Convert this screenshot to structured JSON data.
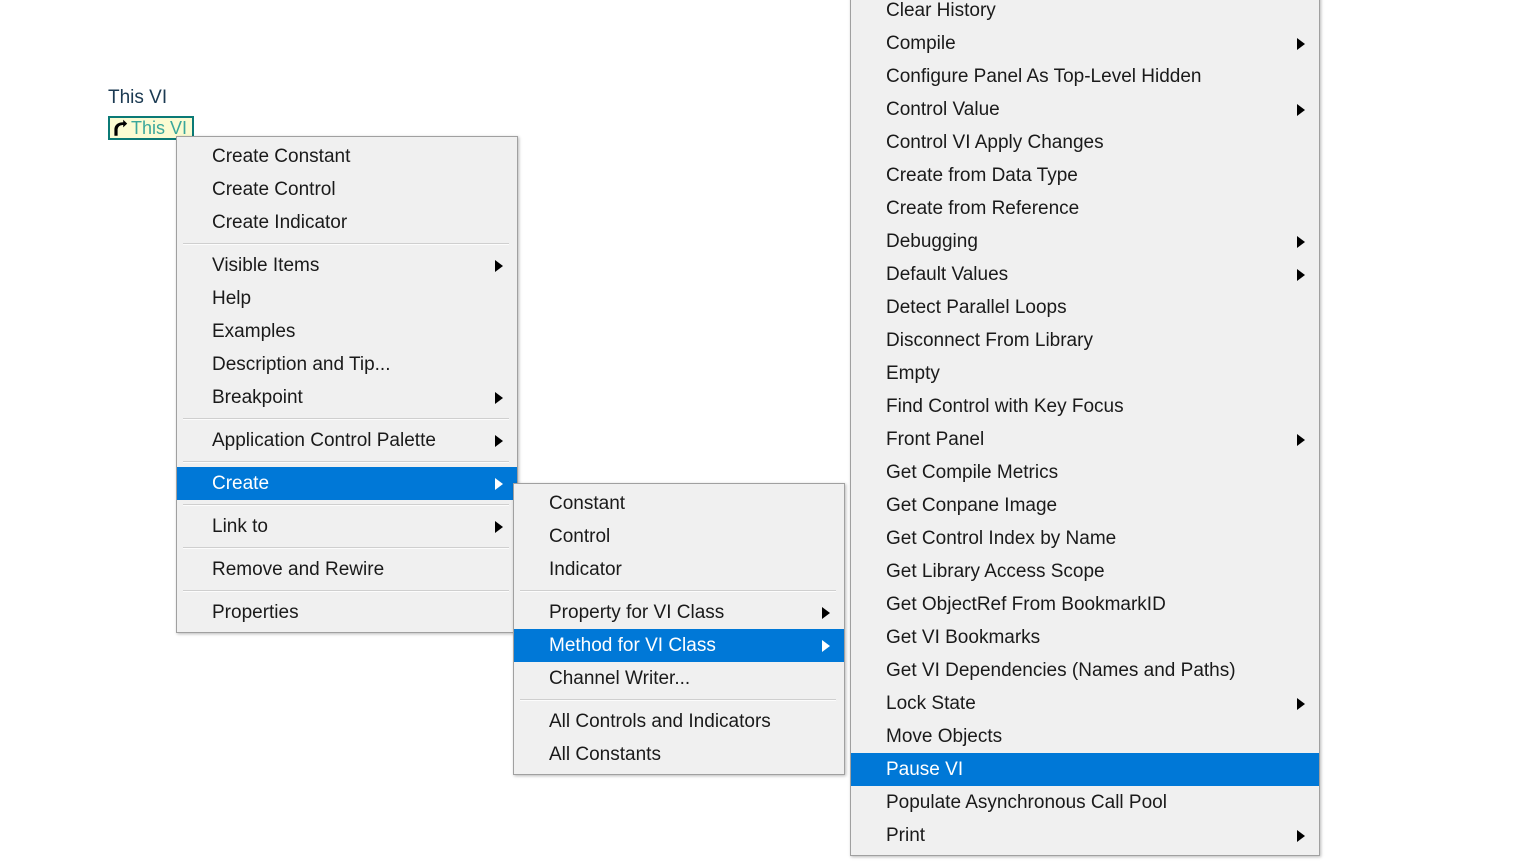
{
  "diagram": {
    "node_caption": "This VI",
    "node_label": "This VI",
    "node_icon": "this-vi-reference-icon",
    "node_border_color": "#0b7a76",
    "node_background_color": "#fbfbd2",
    "node_text_color": "#3aa79b",
    "caption_text_color": "#1b3a52"
  },
  "theme": {
    "menu_background": "#f0f0f0",
    "menu_border": "#a0a0a0",
    "menu_text": "#1a1a1a",
    "highlight_background": "#0078d7",
    "highlight_text": "#ffffff",
    "separator": "#cfcfcf"
  },
  "menus": {
    "primary": {
      "name": "this-vi-context-menu",
      "items": [
        {
          "label": "Create Constant",
          "submenu": false,
          "highlighted": false
        },
        {
          "label": "Create Control",
          "submenu": false,
          "highlighted": false
        },
        {
          "label": "Create Indicator",
          "submenu": false,
          "highlighted": false
        },
        {
          "separator": true
        },
        {
          "label": "Visible Items",
          "submenu": true,
          "highlighted": false
        },
        {
          "label": "Help",
          "submenu": false,
          "highlighted": false
        },
        {
          "label": "Examples",
          "submenu": false,
          "highlighted": false
        },
        {
          "label": "Description and Tip...",
          "submenu": false,
          "highlighted": false
        },
        {
          "label": "Breakpoint",
          "submenu": true,
          "highlighted": false
        },
        {
          "separator": true
        },
        {
          "label": "Application Control Palette",
          "submenu": true,
          "highlighted": false
        },
        {
          "separator": true
        },
        {
          "label": "Create",
          "submenu": true,
          "highlighted": true
        },
        {
          "separator": true
        },
        {
          "label": "Link to",
          "submenu": true,
          "highlighted": false
        },
        {
          "separator": true
        },
        {
          "label": "Remove and Rewire",
          "submenu": false,
          "highlighted": false
        },
        {
          "separator": true
        },
        {
          "label": "Properties",
          "submenu": false,
          "highlighted": false
        }
      ]
    },
    "create": {
      "name": "create-submenu",
      "items": [
        {
          "label": "Constant",
          "submenu": false,
          "highlighted": false
        },
        {
          "label": "Control",
          "submenu": false,
          "highlighted": false
        },
        {
          "label": "Indicator",
          "submenu": false,
          "highlighted": false
        },
        {
          "separator": true
        },
        {
          "label": "Property for VI Class",
          "submenu": true,
          "highlighted": false
        },
        {
          "label": "Method for VI Class",
          "submenu": true,
          "highlighted": true
        },
        {
          "label": "Channel Writer...",
          "submenu": false,
          "highlighted": false
        },
        {
          "separator": true
        },
        {
          "label": "All Controls and Indicators",
          "submenu": false,
          "highlighted": false
        },
        {
          "label": "All Constants",
          "submenu": false,
          "highlighted": false
        }
      ]
    },
    "method": {
      "name": "method-for-vi-class-submenu",
      "items": [
        {
          "label": "Clear History",
          "submenu": false,
          "highlighted": false
        },
        {
          "label": "Compile",
          "submenu": true,
          "highlighted": false
        },
        {
          "label": "Configure Panel As Top-Level Hidden",
          "submenu": false,
          "highlighted": false
        },
        {
          "label": "Control Value",
          "submenu": true,
          "highlighted": false
        },
        {
          "label": "Control VI Apply Changes",
          "submenu": false,
          "highlighted": false
        },
        {
          "label": "Create from Data Type",
          "submenu": false,
          "highlighted": false
        },
        {
          "label": "Create from Reference",
          "submenu": false,
          "highlighted": false
        },
        {
          "label": "Debugging",
          "submenu": true,
          "highlighted": false
        },
        {
          "label": "Default Values",
          "submenu": true,
          "highlighted": false
        },
        {
          "label": "Detect Parallel Loops",
          "submenu": false,
          "highlighted": false
        },
        {
          "label": "Disconnect From Library",
          "submenu": false,
          "highlighted": false
        },
        {
          "label": "Empty",
          "submenu": false,
          "highlighted": false
        },
        {
          "label": "Find Control with Key Focus",
          "submenu": false,
          "highlighted": false
        },
        {
          "label": "Front Panel",
          "submenu": true,
          "highlighted": false
        },
        {
          "label": "Get Compile Metrics",
          "submenu": false,
          "highlighted": false
        },
        {
          "label": "Get Conpane Image",
          "submenu": false,
          "highlighted": false
        },
        {
          "label": "Get Control Index by Name",
          "submenu": false,
          "highlighted": false
        },
        {
          "label": "Get Library Access Scope",
          "submenu": false,
          "highlighted": false
        },
        {
          "label": "Get ObjectRef From BookmarkID",
          "submenu": false,
          "highlighted": false
        },
        {
          "label": "Get VI Bookmarks",
          "submenu": false,
          "highlighted": false
        },
        {
          "label": "Get VI Dependencies (Names and Paths)",
          "submenu": false,
          "highlighted": false
        },
        {
          "label": "Lock State",
          "submenu": true,
          "highlighted": false
        },
        {
          "label": "Move Objects",
          "submenu": false,
          "highlighted": false
        },
        {
          "label": "Pause VI",
          "submenu": false,
          "highlighted": true
        },
        {
          "label": "Populate Asynchronous Call Pool",
          "submenu": false,
          "highlighted": false
        },
        {
          "label": "Print",
          "submenu": true,
          "highlighted": false
        }
      ]
    }
  }
}
